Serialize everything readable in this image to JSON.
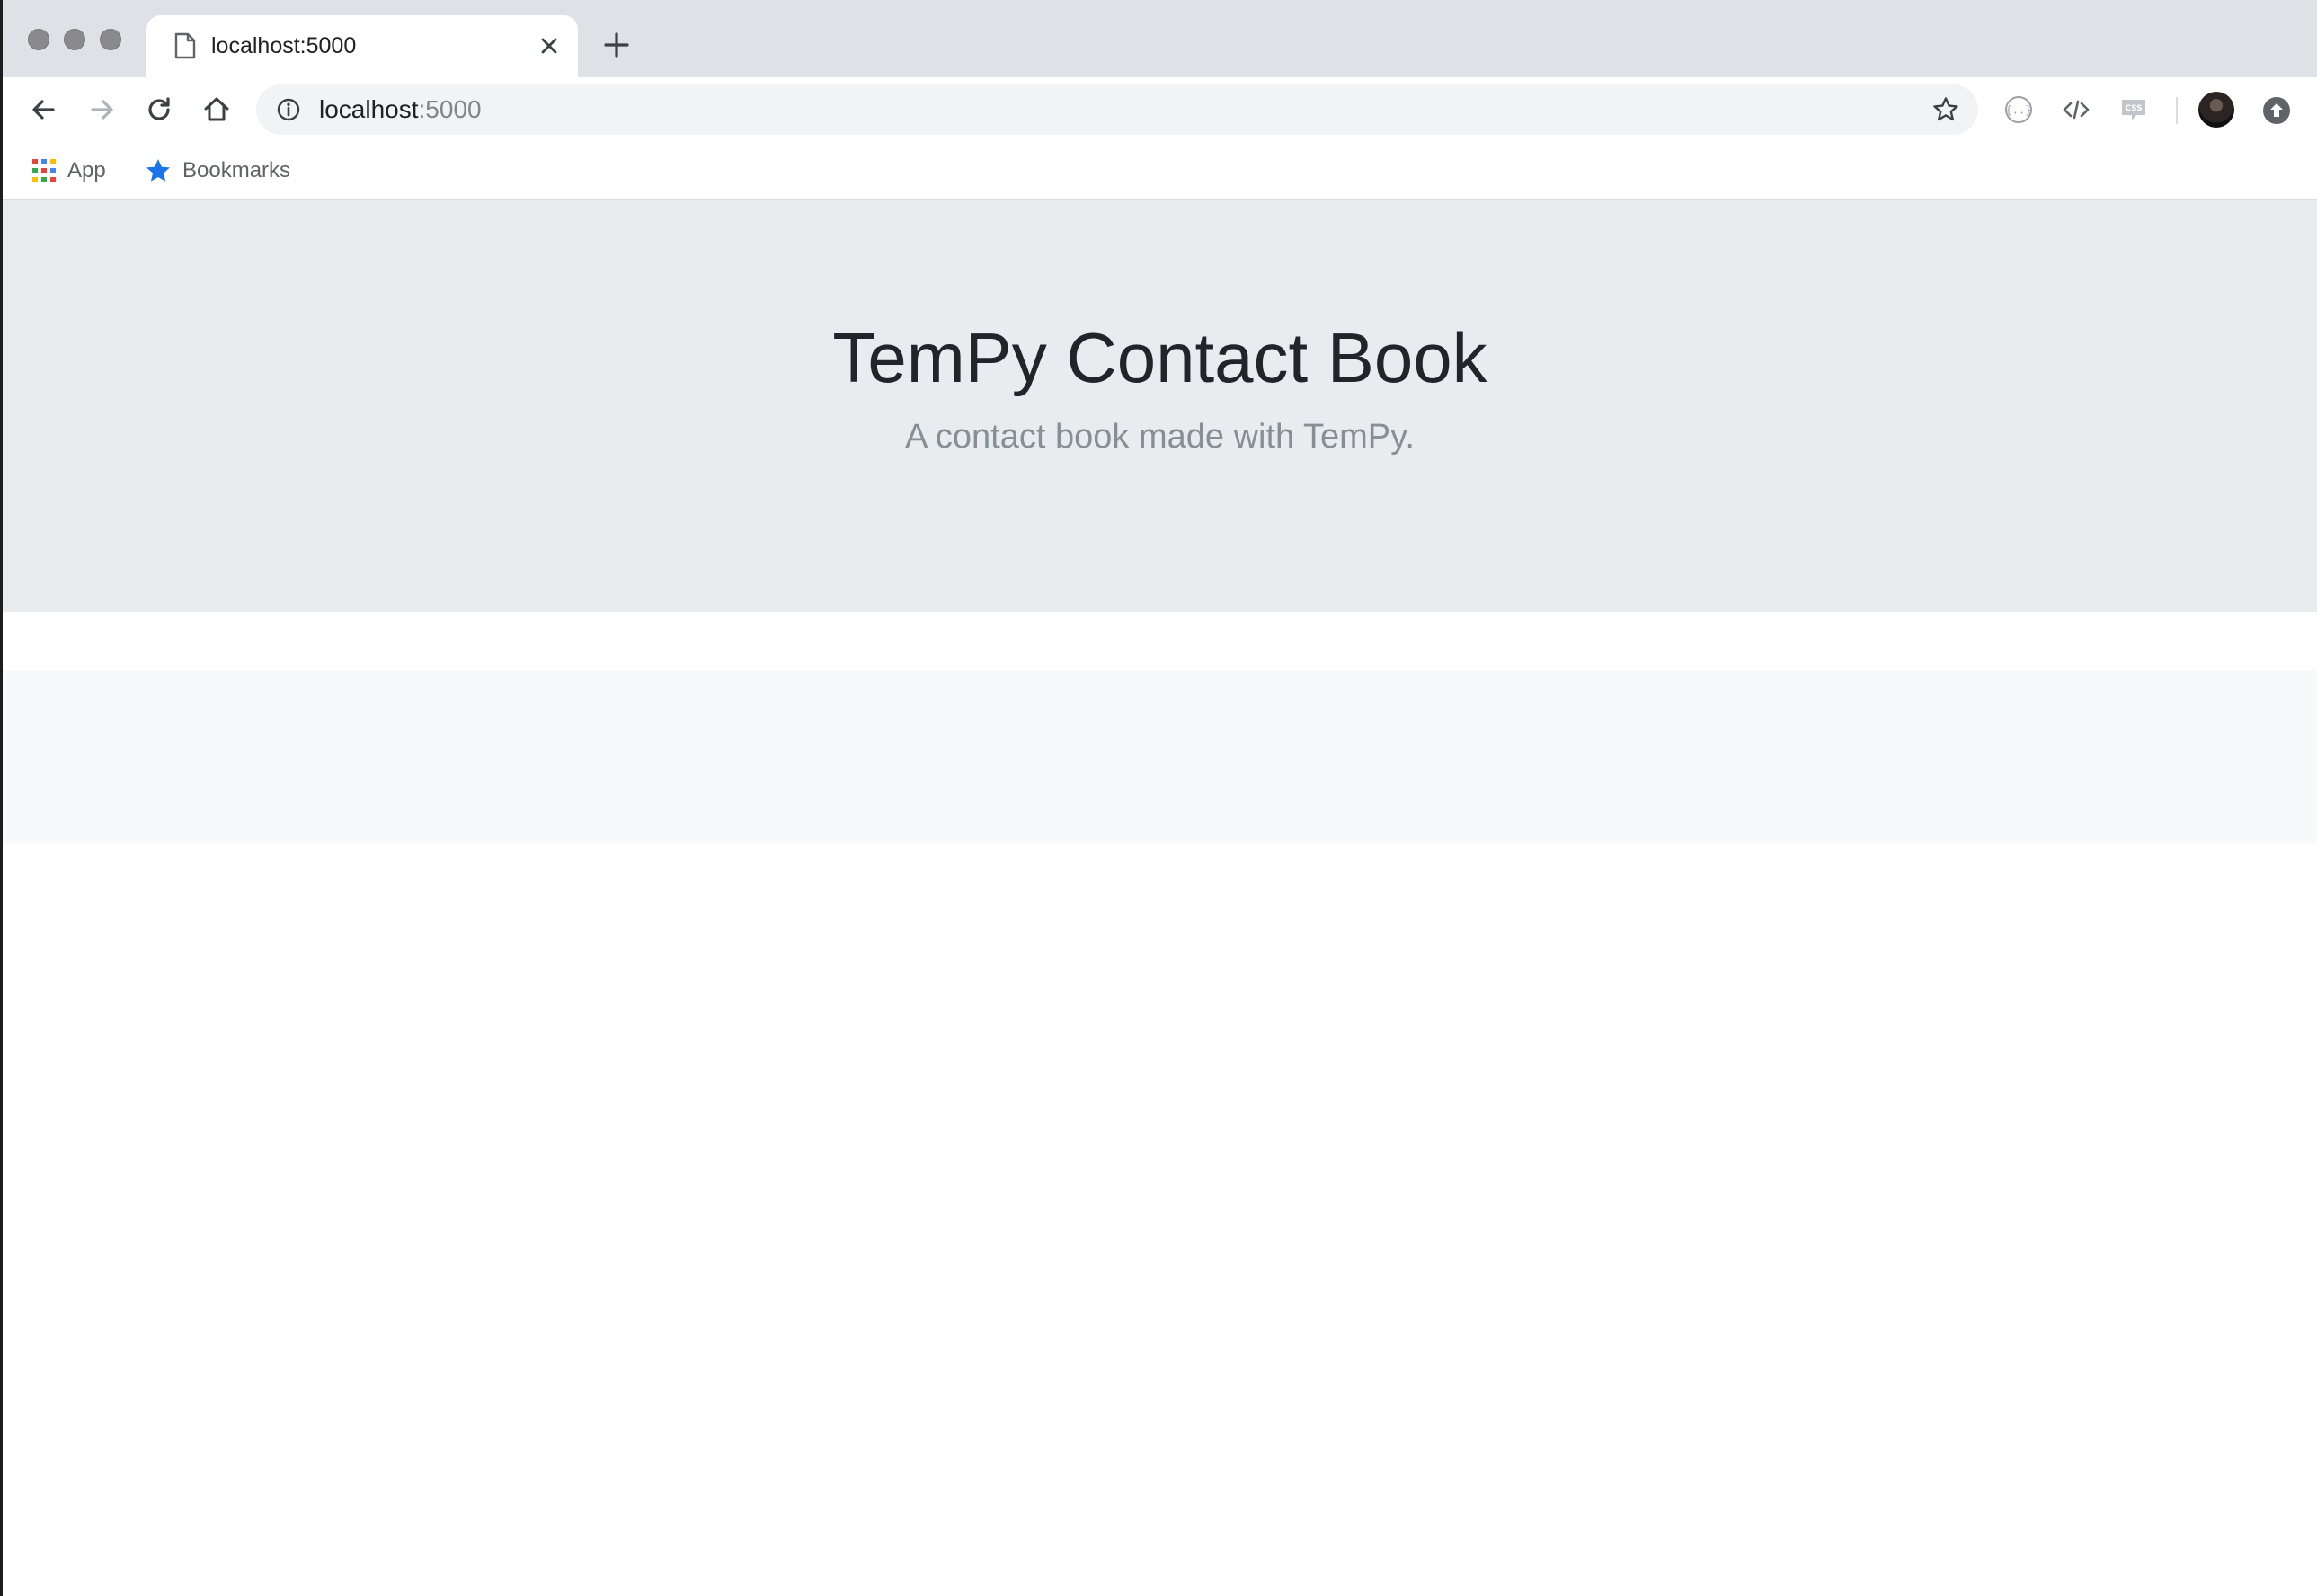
{
  "browser": {
    "tab": {
      "title": "localhost:5000"
    },
    "address_bar": {
      "host": "localhost",
      "port": ":5000"
    },
    "bookmarks": [
      {
        "label": "App",
        "icon": "apps-grid-icon"
      },
      {
        "label": "Bookmarks",
        "icon": "star-icon"
      }
    ]
  },
  "page": {
    "title": "TemPy Contact Book",
    "lead": "A contact book made with TemPy."
  },
  "colors": {
    "jumbotron_bg": "#e9ecef",
    "light_section_bg": "#f8f9fa",
    "title_text": "#212529",
    "lead_text": "#868e96",
    "tabstrip_bg": "#dee1e6"
  }
}
